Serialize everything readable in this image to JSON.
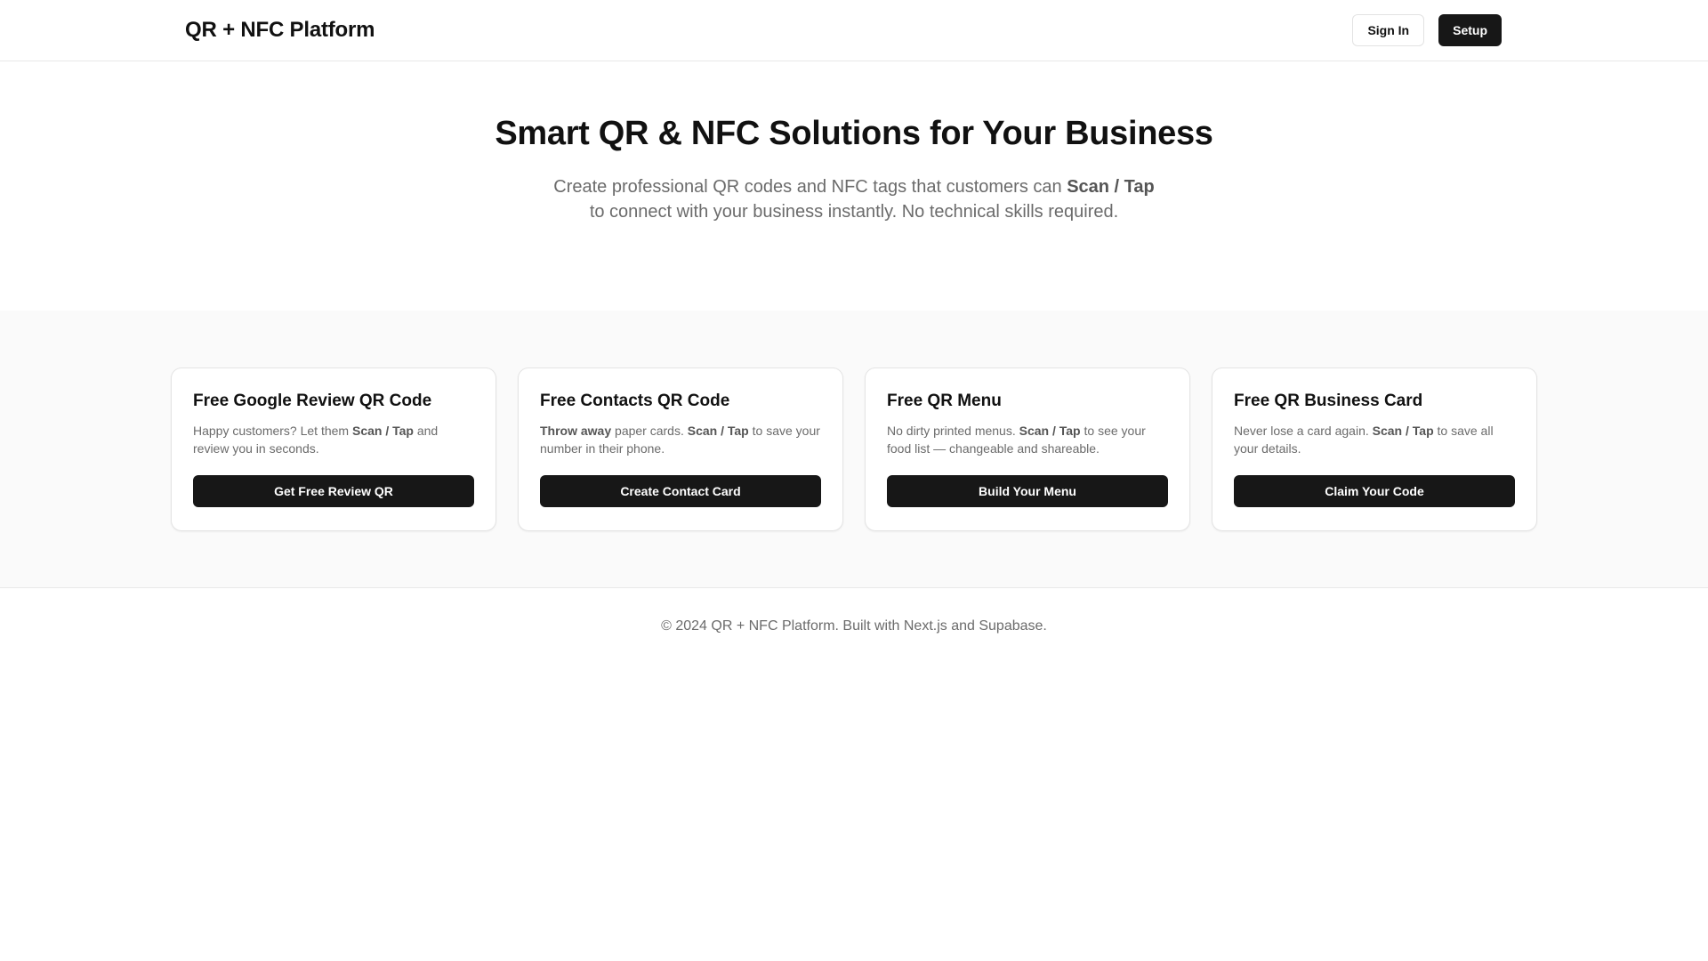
{
  "header": {
    "brand": "QR + NFC Platform",
    "sign_in_label": "Sign In",
    "setup_label": "Setup"
  },
  "hero": {
    "title": "Smart QR & NFC Solutions for Your Business",
    "subtitle_pre": "Create professional QR codes and NFC tags that customers can ",
    "subtitle_bold": "Scan / Tap",
    "subtitle_post": " to connect with your business instantly. No technical skills required."
  },
  "cards": [
    {
      "title": "Free Google Review QR Code",
      "desc_pre": "Happy customers? Let them ",
      "desc_bold": "Scan / Tap",
      "desc_post": " and review you in seconds.",
      "button": "Get Free Review QR"
    },
    {
      "title": "Free Contacts QR Code",
      "desc_bold_lead": "Throw away",
      "desc_pre": " paper cards. ",
      "desc_bold": "Scan / Tap",
      "desc_post": " to save your number in their phone.",
      "button": "Create Contact Card"
    },
    {
      "title": "Free QR Menu",
      "desc_pre": "No dirty printed menus. ",
      "desc_bold": "Scan / Tap",
      "desc_post": " to see your food list — changeable and shareable.",
      "button": "Build Your Menu"
    },
    {
      "title": "Free QR Business Card",
      "desc_pre": "Never lose a card again. ",
      "desc_bold": "Scan / Tap",
      "desc_post": " to save all your details.",
      "button": "Claim Your Code"
    }
  ],
  "footer": {
    "text": "© 2024 QR + NFC Platform. Built with Next.js and Supabase."
  },
  "colors": {
    "primary_button": "#171717",
    "muted_text": "#6b6b6b",
    "section_background": "#fafafa"
  }
}
